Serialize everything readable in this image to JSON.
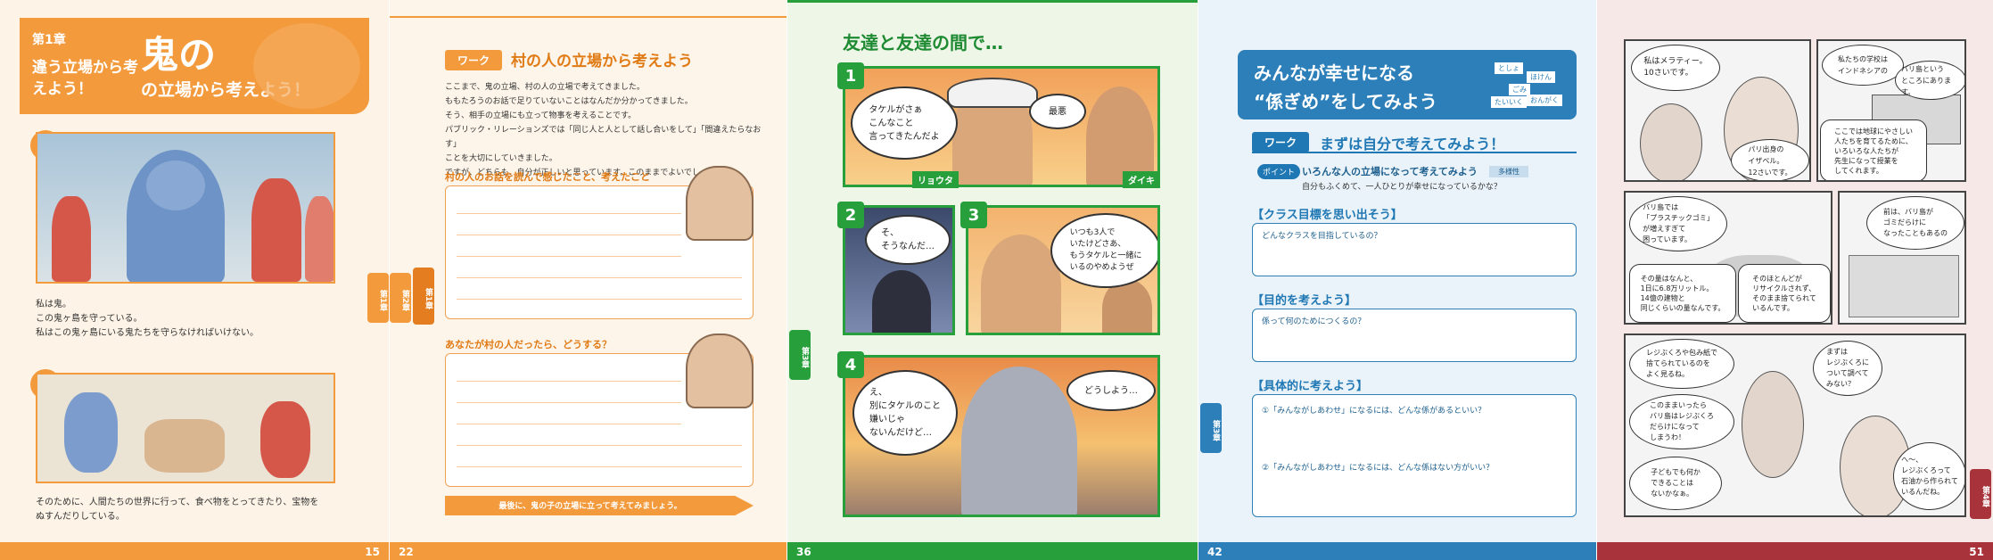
{
  "p15": {
    "chapter": "第1章",
    "title_small": "違う立場から考えよう！",
    "title_big": "鬼の",
    "title_rest": "の立場から考えよう！",
    "scene1_num": "1",
    "scene2_num": "2",
    "text1_l1": "私は鬼。",
    "text1_l2": "この鬼ヶ島を守っている。",
    "text1_l3": "私はこの鬼ヶ島にいる鬼たちを守らなければいけない。",
    "text2_l1": "そのために、人間たちの世界に行って、食べ物をとってきたり、宝物を",
    "text2_l2": "ぬすんだりしている。",
    "page_number": "15",
    "side_tab": "第1章"
  },
  "p22": {
    "work_label": "ワーク",
    "work_title": "村の人の立場から考えよう",
    "intro": [
      "ここまで、鬼の立場、村の人の立場で考えてきました。",
      "ももたろうのお話で足りていないことはなんだか分かってきました。",
      "そう、相手の立場にも立って物事を考えることです。",
      "パブリック・リレーションズでは「同じ人と人として話し合いをして」「間違えたらなおす」",
      "ことを大切にしていきました。",
      "ですが、どちらも、自分が正しいと思っています。このままでよいでしょうか。"
    ],
    "q1": "村の人のお話を読んで感じたこと、考えたこと",
    "q2": "あなたが村の人だったら、どうする？",
    "bottom_bar": "最後に、鬼の子の立場に立って考えてみましょう。",
    "page_number": "22",
    "side_tab_a": "第1章",
    "side_tab_b": "第2章"
  },
  "p36": {
    "title": "友達と友達の間で…",
    "panel1_num": "1",
    "panel2_num": "2",
    "panel3_num": "3",
    "panel4_num": "4",
    "bubble1": "タケルがさぁ\nこんなこと\n言ってきたんだよ",
    "bubble2": "最悪",
    "name1": "リョウタ",
    "name2": "ダイキ",
    "bubble3": "そ、\nそうなんだ…",
    "bubble4": "いつも3人で\nいたけどさあ、\nもうタケルと一緒に\nいるのやめようぜ",
    "bubble5": "え、\n別にタケルのこと\n嫌いじゃ\nないんだけど…",
    "bubble6": "どうしよう…",
    "page_number": "36",
    "side_tab": "第3章"
  },
  "p42": {
    "title_l1": "みんなが幸せになる",
    "title_l2": "“係ぎめ”をしてみよう",
    "tags": [
      "としょ",
      "ほけん",
      "ごみ",
      "たいいく",
      "おんがく"
    ],
    "work_label": "ワーク",
    "work_title": "まずは自分で考えてみよう！",
    "point_label": "ポイント",
    "point_text": "いろんな人の立場になって考えてみよう",
    "point_badge": "多様性",
    "point_sub": "自分もふくめて、一人ひとりが幸せになっているかな？",
    "h1": "【クラス目標を思い出そう】",
    "box1": "どんなクラスを目指しているの？",
    "h2": "【目的を考えよう】",
    "box2": "係って何のためにつくるの？",
    "h3": "【具体的に考えよう】",
    "box3a": "①「みんながしあわせ」になるには、どんな係があるといい？",
    "box3b": "②「みんながしあわせ」になるには、どんな係はない方がいい？",
    "page_number": "42",
    "side_tab": "第3章"
  },
  "p51": {
    "b1": "私はメラティー。\n10さいです。",
    "b2": "パリ出身の\nイザベル。\n12さいです。",
    "b3": "私たちの学校は\nインドネシアの",
    "b4": "バリ島という\nところにあります。",
    "b5": "ここでは地球にやさしい\n人たちを育てるために、\nいろいろな人たちが\n先生になって授業を\nしてくれます。",
    "b6": "バリ島では\n「プラスチックゴミ」\nが増えすぎて\n困っています。",
    "b7": "前は、バリ島が\nゴミだらけに\nなったこともあるの",
    "b8": "その量はなんと、\n1日に6.8万リットル。\n14億の建物と\n同じくらいの量なんです。",
    "b9": "そのほとんどが\nリサイクルされず、\nそのまま捨てられて\nいるんです。",
    "b10": "レジぶくろや包み紙で\n捨てられているのを\nよく見るね。",
    "b11": "まずは\nレジぶくろに\nついて調べて\nみない？",
    "b12": "このままいったら\nバリ島はレジぶくろ\nだらけになって\nしまうわ！",
    "b13": "子どもでも何か\nできることは\nないかなぁ。",
    "b14": "へ～、\nレジぶくろって\n石油から作られて\nいるんだね。",
    "page_number": "51",
    "side_tab": "第4章"
  }
}
